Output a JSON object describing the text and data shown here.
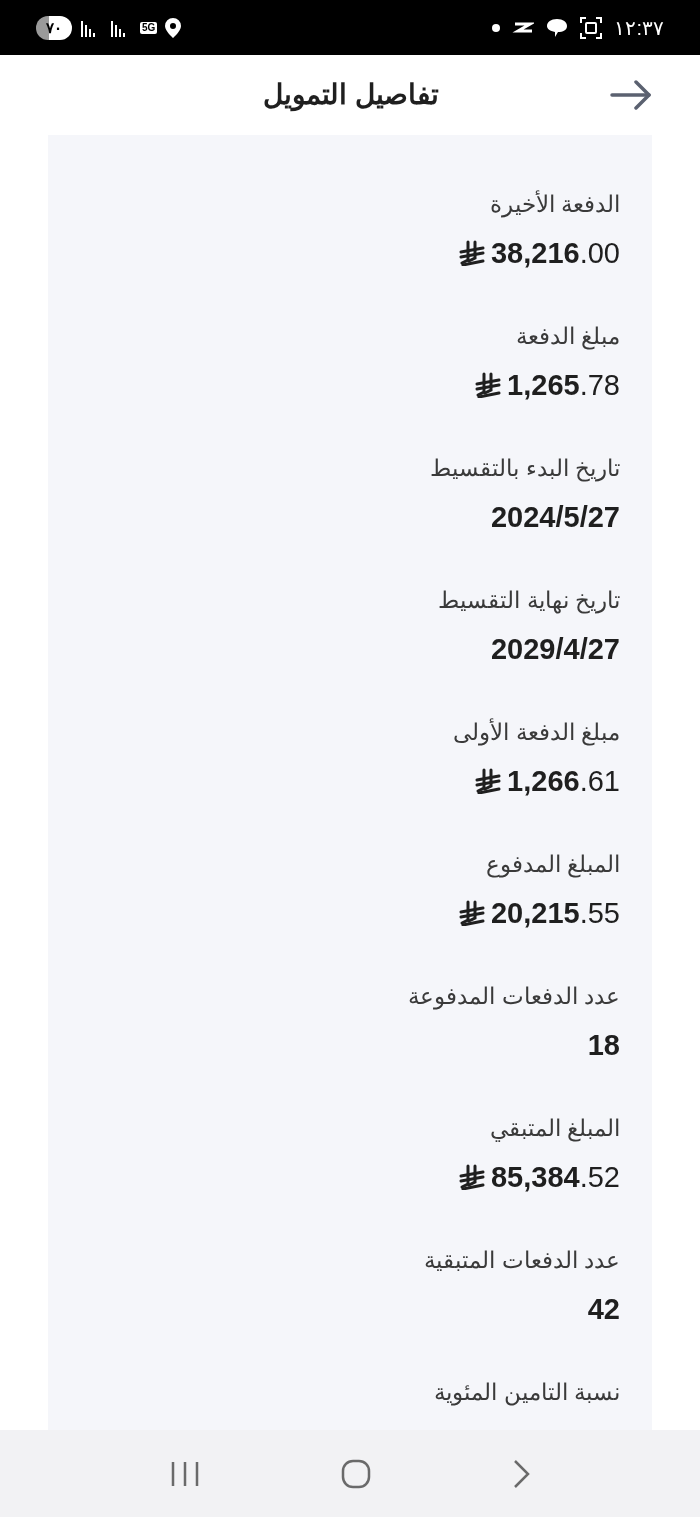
{
  "status_bar": {
    "battery": "٧٠",
    "network": "5G",
    "time": "١٢:٣٧"
  },
  "header": {
    "title": "تفاصيل التمويل"
  },
  "items": [
    {
      "kind": "amount",
      "label": "الدفعة الأخيرة",
      "value": "**38,216**.00"
    },
    {
      "kind": "amount",
      "label": "مبلغ الدفعة",
      "value": "**1,265**.78"
    },
    {
      "kind": "plain",
      "label": "تاريخ البدء بالتقسيط",
      "value": "2024/5/27"
    },
    {
      "kind": "plain",
      "label": "تاريخ نهاية التقسيط",
      "value": "2029/4/27"
    },
    {
      "kind": "amount",
      "label": "مبلغ الدفعة الأولى",
      "value": "**1,266**.61"
    },
    {
      "kind": "amount",
      "label": "المبلغ المدفوع",
      "value": "**20,215**.55"
    },
    {
      "kind": "plain",
      "label": "عدد الدفعات المدفوعة",
      "value": "18"
    },
    {
      "kind": "amount",
      "label": "المبلغ المتبقي",
      "value": "**85,384**.52"
    },
    {
      "kind": "plain",
      "label": "عدد الدفعات المتبقية",
      "value": "42"
    },
    {
      "kind": "label",
      "label": "نسبة التامين المئوية"
    }
  ]
}
